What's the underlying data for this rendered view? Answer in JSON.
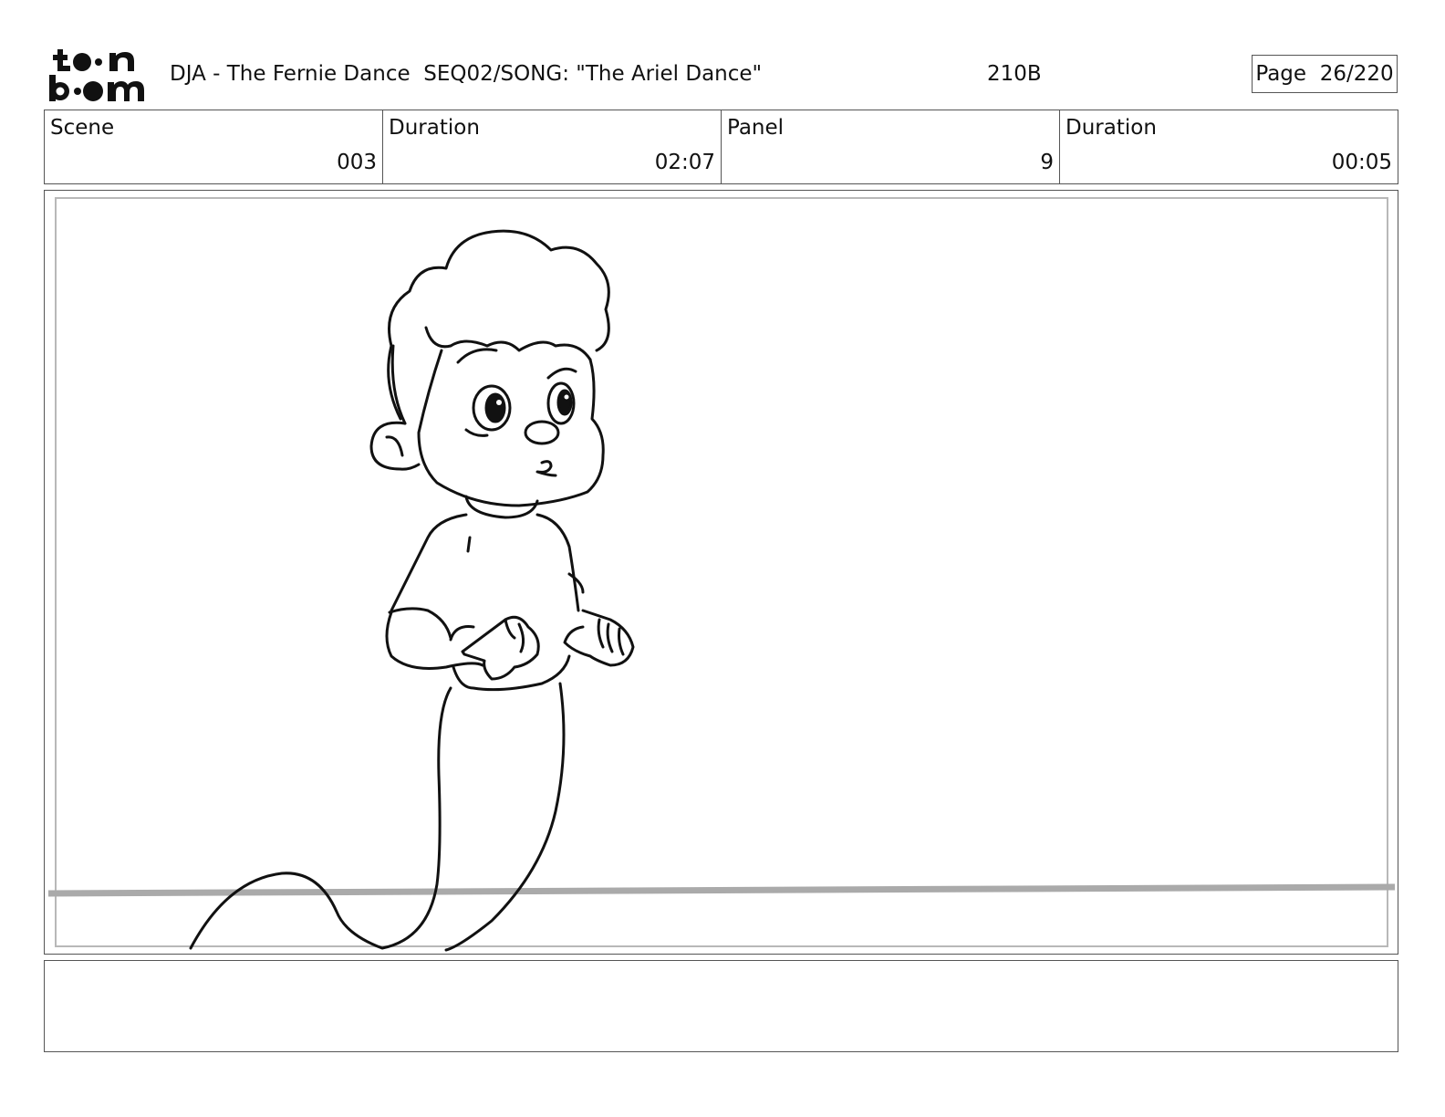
{
  "header": {
    "logo_text": "toon boom",
    "title": "DJA - The Fernie Dance  SEQ02/SONG: \"The Ariel Dance\"",
    "panel_id": "210B",
    "page_label": "Page",
    "page_value": "26/220"
  },
  "info": {
    "scene_label": "Scene",
    "scene_value": "003",
    "scene_duration_label": "Duration",
    "scene_duration_value": "02:07",
    "panel_label": "Panel",
    "panel_value": "9",
    "panel_duration_label": "Duration",
    "panel_duration_value": "00:05"
  },
  "notes": {
    "text": ""
  }
}
